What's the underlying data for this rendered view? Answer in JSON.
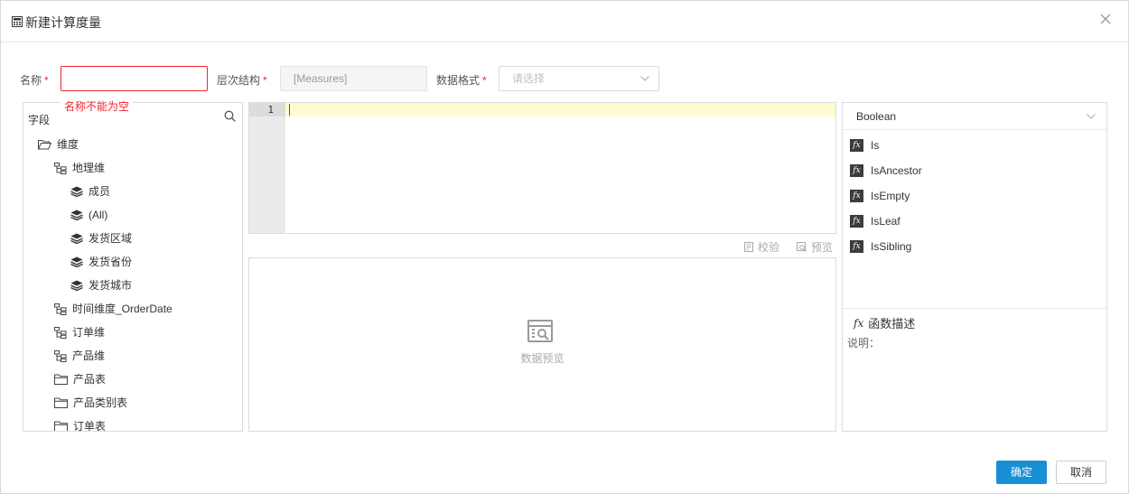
{
  "dialog": {
    "title": "新建计算度量"
  },
  "form": {
    "name_label": "名称",
    "required_mark": "*",
    "name_value": "",
    "name_error": "名称不能为空",
    "hierarchy_label": "层次结构",
    "hierarchy_value": "[Measures]",
    "format_label": "数据格式",
    "format_placeholder": "请选择"
  },
  "fields": {
    "title": "字段",
    "items": [
      {
        "label": "维度",
        "icon": "folder-open-icon"
      },
      {
        "label": "地理维",
        "icon": "hierarchy-icon"
      },
      {
        "label": "成员",
        "icon": "layers-icon"
      },
      {
        "label": "(All)",
        "icon": "layers-icon"
      },
      {
        "label": "发货区域",
        "icon": "layers-icon"
      },
      {
        "label": "发货省份",
        "icon": "layers-icon"
      },
      {
        "label": "发货城市",
        "icon": "layers-icon"
      },
      {
        "label": "时间维度_OrderDate",
        "icon": "hierarchy-icon"
      },
      {
        "label": "订单维",
        "icon": "hierarchy-icon"
      },
      {
        "label": "产品维",
        "icon": "hierarchy-icon"
      },
      {
        "label": "产品表",
        "icon": "folder-icon"
      },
      {
        "label": "产品类别表",
        "icon": "folder-icon"
      },
      {
        "label": "订单表",
        "icon": "folder-icon"
      }
    ]
  },
  "editor": {
    "line_number": "1",
    "content": ""
  },
  "toolbar": {
    "validate_label": "校验",
    "preview_label": "预览"
  },
  "preview": {
    "placeholder": "数据预览"
  },
  "functions": {
    "category": "Boolean",
    "items": [
      "Is",
      "IsAncestor",
      "IsEmpty",
      "IsLeaf",
      "IsSibling"
    ],
    "fx_glyph": "fx",
    "desc_title": "函数描述",
    "desc_label": "说明："
  },
  "buttons": {
    "ok": "确定",
    "cancel": "取消"
  },
  "colors": {
    "primary": "#1890d5",
    "error": "#f5222d",
    "active_line": "#fffbd1"
  }
}
